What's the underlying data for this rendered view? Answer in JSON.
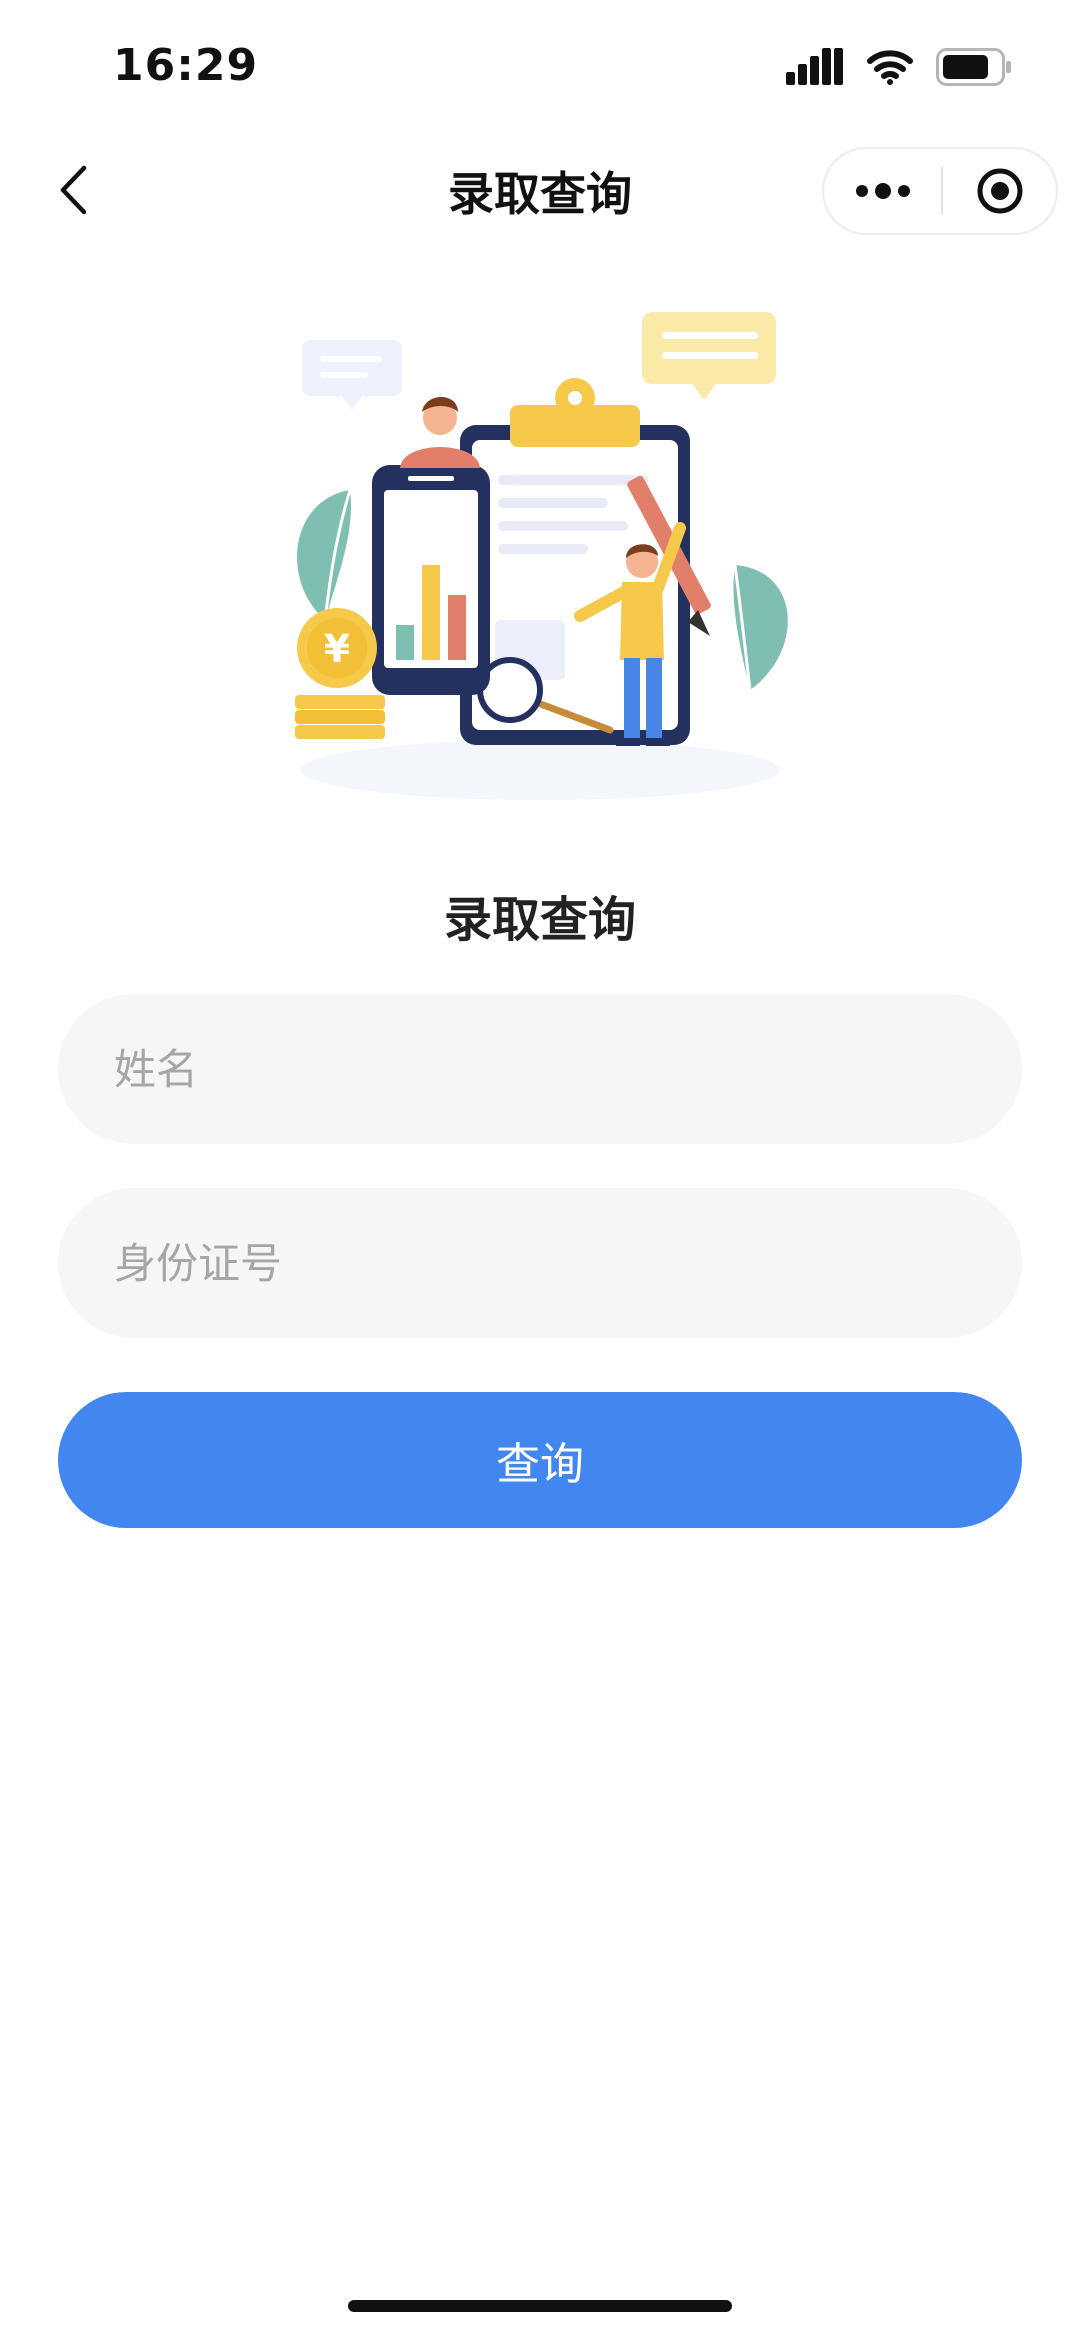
{
  "status_bar": {
    "time": "16:29",
    "icons": [
      "cellular-signal-icon",
      "wifi-icon",
      "battery-icon"
    ]
  },
  "nav": {
    "title": "录取查询",
    "back_icon": "chevron-left-icon",
    "more_icon": "more-dots-icon",
    "close_icon": "target-circle-icon"
  },
  "form": {
    "title": "录取查询",
    "name_placeholder": "姓名",
    "name_value": "",
    "id_placeholder": "身份证号",
    "id_value": "",
    "submit_label": "查询"
  },
  "colors": {
    "primary": "#4286f0",
    "input_bg": "#f5f6f8",
    "placeholder": "#a6a6a6"
  }
}
